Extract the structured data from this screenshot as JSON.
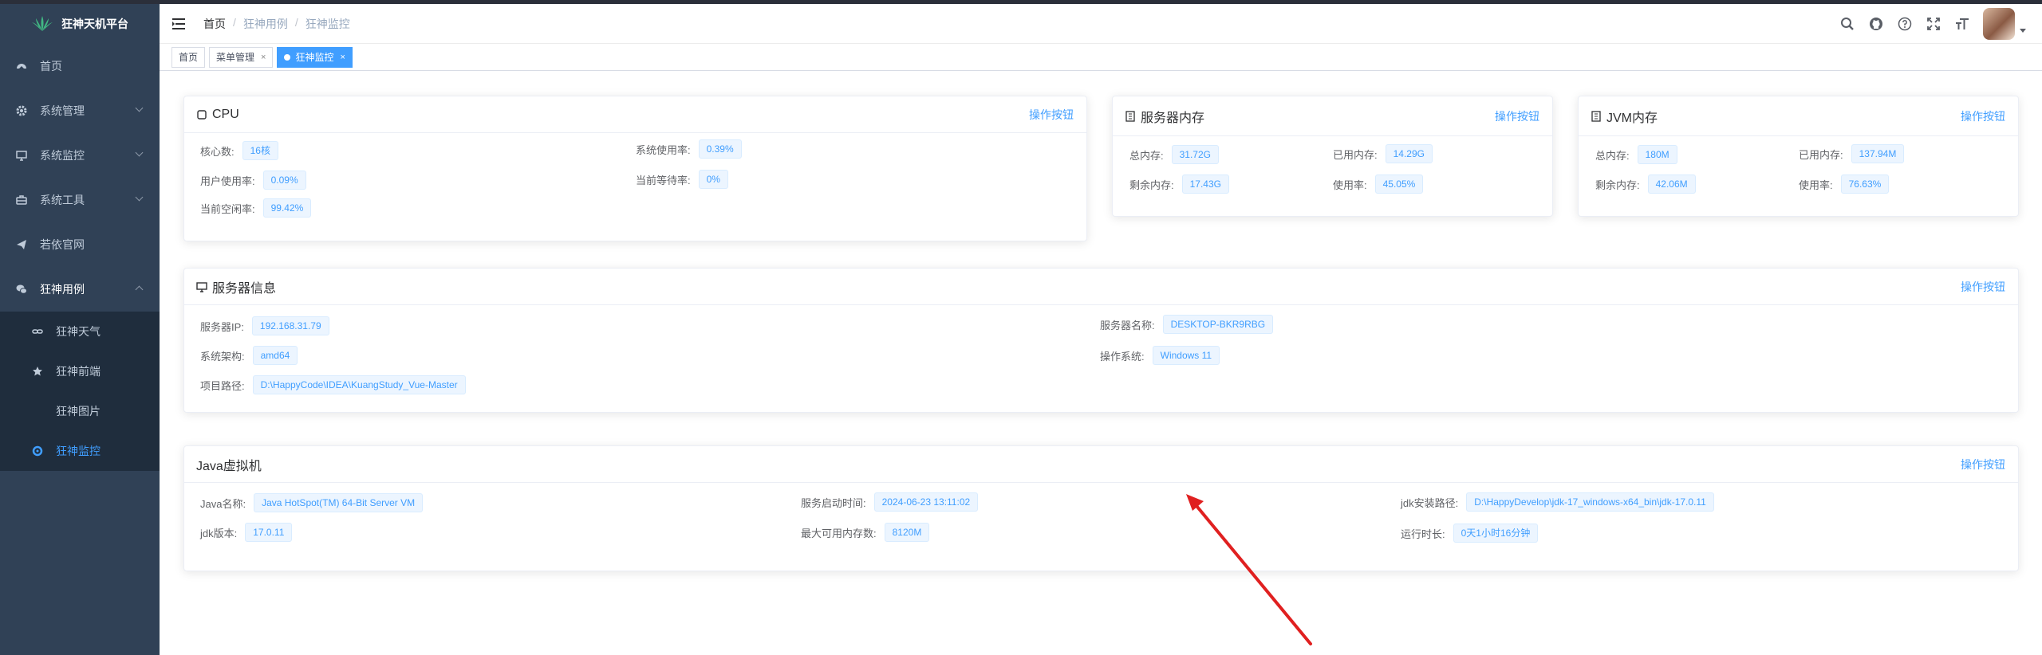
{
  "app": {
    "title": "狂神天机平台"
  },
  "sidebar": {
    "items": [
      {
        "label": "首页",
        "icon": "dashboard-icon"
      },
      {
        "label": "系统管理",
        "icon": "gear-icon"
      },
      {
        "label": "系统监控",
        "icon": "monitor-icon"
      },
      {
        "label": "系统工具",
        "icon": "toolbox-icon"
      },
      {
        "label": "若依官网",
        "icon": "send-icon"
      },
      {
        "label": "狂神用例",
        "icon": "wechat-icon"
      },
      {
        "label": "狂神天气",
        "icon": "link-icon"
      },
      {
        "label": "狂神前端",
        "icon": "star-icon"
      },
      {
        "label": "狂神图片",
        "icon": ""
      },
      {
        "label": "狂神监控",
        "icon": "monitor-ring-icon"
      }
    ]
  },
  "breadcrumb": [
    "首页",
    "狂神用例",
    "狂神监控"
  ],
  "tags": [
    {
      "label": "首页"
    },
    {
      "label": "菜单管理"
    },
    {
      "label": "狂神监控"
    }
  ],
  "colors": {
    "accent": "#409eff",
    "sidebar": "#304156",
    "submenu": "#1f2d3d",
    "arrow": "#e02020"
  },
  "action_label": "操作按钮",
  "cpu": {
    "title": "CPU",
    "rows": [
      {
        "label": "核心数:",
        "value": "16核"
      },
      {
        "label": "系统使用率:",
        "value": "0.39%"
      },
      {
        "label": "用户使用率:",
        "value": "0.09%"
      },
      {
        "label": "当前等待率:",
        "value": "0%"
      },
      {
        "label": "当前空闲率:",
        "value": "99.42%"
      }
    ]
  },
  "mem": {
    "title": "服务器内存",
    "rows": [
      {
        "label": "总内存:",
        "value": "31.72G"
      },
      {
        "label": "已用内存:",
        "value": "14.29G"
      },
      {
        "label": "剩余内存:",
        "value": "17.43G"
      },
      {
        "label": "使用率:",
        "value": "45.05%"
      }
    ]
  },
  "jvm": {
    "title": "JVM内存",
    "rows": [
      {
        "label": "总内存:",
        "value": "180M"
      },
      {
        "label": "已用内存:",
        "value": "137.94M"
      },
      {
        "label": "剩余内存:",
        "value": "42.06M"
      },
      {
        "label": "使用率:",
        "value": "76.63%"
      }
    ]
  },
  "server": {
    "title": "服务器信息",
    "rows": [
      {
        "label": "服务器IP:",
        "value": "192.168.31.79"
      },
      {
        "label": "服务器名称:",
        "value": "DESKTOP-BKR9RBG"
      },
      {
        "label": "系统架构:",
        "value": "amd64"
      },
      {
        "label": "操作系统:",
        "value": "Windows 11"
      },
      {
        "label": "项目路径:",
        "value": "D:\\HappyCode\\IDEA\\KuangStudy_Vue-Master"
      }
    ]
  },
  "java": {
    "title": "Java虚拟机",
    "rows": [
      {
        "label": "Java名称:",
        "value": "Java HotSpot(TM) 64-Bit Server VM"
      },
      {
        "label": "服务启动时间:",
        "value": "2024-06-23 13:11:02"
      },
      {
        "label": "jdk安装路径:",
        "value": "D:\\HappyDevelop\\jdk-17_windows-x64_bin\\jdk-17.0.11"
      },
      {
        "label": "jdk版本:",
        "value": "17.0.11"
      },
      {
        "label": "最大可用内存数:",
        "value": "8120M"
      },
      {
        "label": "运行时长:",
        "value": "0天1小时16分钟"
      }
    ]
  }
}
